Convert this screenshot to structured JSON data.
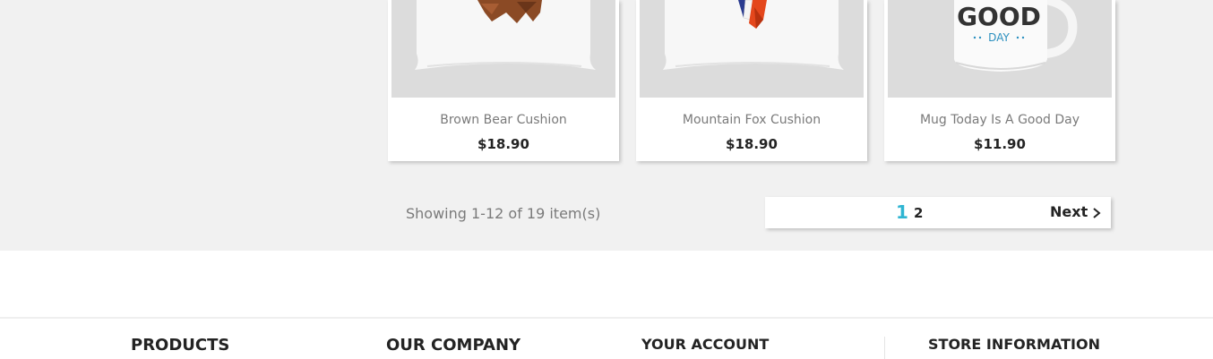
{
  "products": [
    {
      "name": "Brown Bear Cushion",
      "price": "$18.90"
    },
    {
      "name": "Mountain Fox Cushion",
      "price": "$18.90"
    },
    {
      "name": "Mug Today Is A Good Day",
      "price": "$11.90",
      "mug_text_1": "GOOD",
      "mug_text_2": "DAY"
    }
  ],
  "listing": {
    "summary": "Showing 1-12 of 19 item(s)"
  },
  "pagination": {
    "current_page": "1",
    "other_page": "2",
    "next_label": "Next",
    "accent": "#2fb5d2"
  },
  "footer": {
    "products_title": "PRODUCTS",
    "company_title": "OUR COMPANY",
    "account_title": "YOUR ACCOUNT",
    "store_title": "STORE INFORMATION"
  }
}
